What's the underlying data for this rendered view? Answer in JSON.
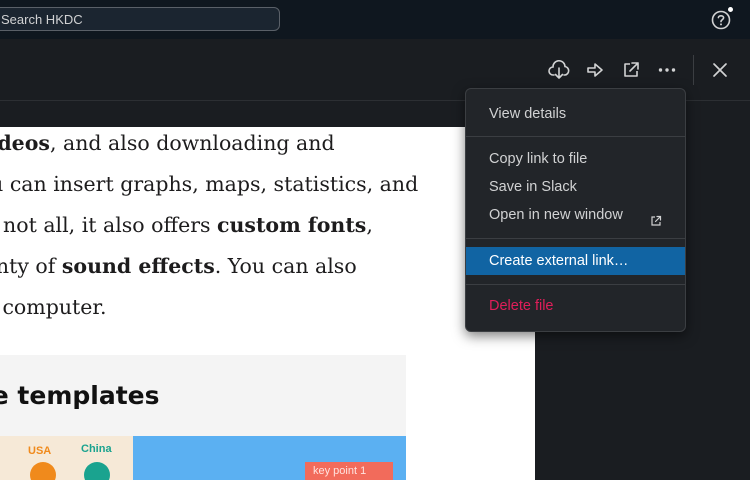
{
  "topbar": {
    "search_text": "Search HKDC",
    "help_icon": "help-icon"
  },
  "toolbar": {
    "buttons": [
      "download-icon",
      "share-icon",
      "open-external-icon",
      "more-icon",
      "close-icon"
    ]
  },
  "document": {
    "lines": [
      [
        {
          "b": true,
          "t": "Videos"
        },
        {
          "b": false,
          "t": ", and also downloading and"
        }
      ],
      [
        {
          "b": false,
          "t": "You can insert graphs, maps, statistics, and"
        }
      ],
      [
        {
          "b": false,
          "t": "But not all, it also offers "
        },
        {
          "b": true,
          "t": "custom fonts"
        },
        {
          "b": false,
          "t": ","
        }
      ],
      [
        {
          "b": false,
          "t": "and plenty of "
        },
        {
          "b": true,
          "t": "sound effects"
        },
        {
          "b": false,
          "t": ". You can also"
        }
      ],
      [
        {
          "b": false,
          "t": "your computer."
        }
      ]
    ],
    "template_title": "Free templates",
    "label_usa": "USA",
    "label_china": "China",
    "keypoint": "key point 1"
  },
  "menu": {
    "items": [
      {
        "id": "view-details",
        "label": "View details"
      },
      {
        "id": "copy-link",
        "label": "Copy link to file"
      },
      {
        "id": "save-in-slack",
        "label": "Save in Slack"
      },
      {
        "id": "open-new-window",
        "label": "Open in new window"
      },
      {
        "id": "create-external-link",
        "label": "Create external link…"
      },
      {
        "id": "delete-file",
        "label": "Delete file"
      }
    ]
  },
  "colors": {
    "accent": "#1164a3",
    "danger": "#e01e5a",
    "topbar": "#0f171f",
    "panel": "#1a1d21"
  }
}
